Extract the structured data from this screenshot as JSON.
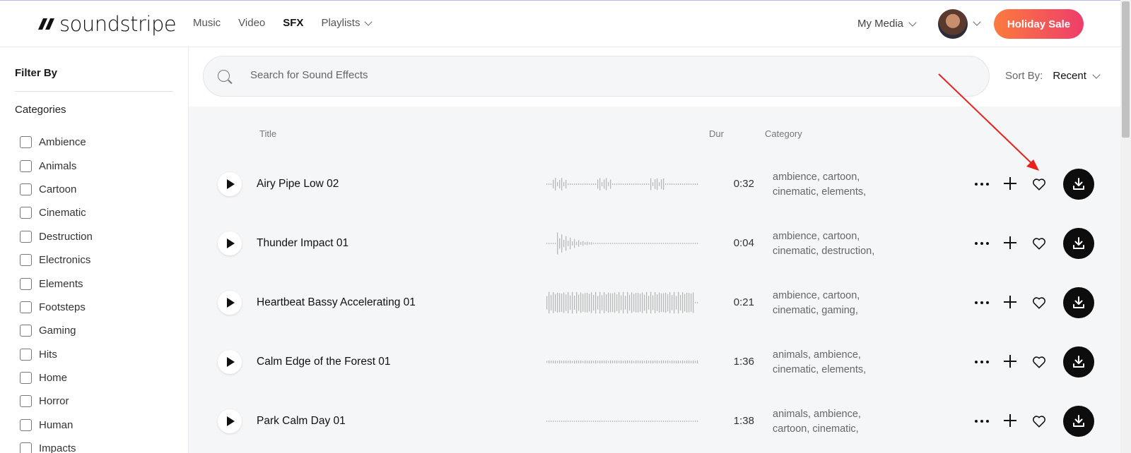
{
  "header": {
    "logo_text": "soundstripe",
    "nav": [
      {
        "label": "Music"
      },
      {
        "label": "Video"
      },
      {
        "label": "SFX"
      },
      {
        "label": "Playlists"
      }
    ],
    "my_media": "My Media",
    "holiday_sale": "Holiday Sale"
  },
  "sidebar": {
    "filter_title": "Filter By",
    "categories_title": "Categories",
    "categories": [
      {
        "label": "Ambience"
      },
      {
        "label": "Animals"
      },
      {
        "label": "Cartoon"
      },
      {
        "label": "Cinematic"
      },
      {
        "label": "Destruction"
      },
      {
        "label": "Electronics"
      },
      {
        "label": "Elements"
      },
      {
        "label": "Footsteps"
      },
      {
        "label": "Gaming"
      },
      {
        "label": "Hits"
      },
      {
        "label": "Home"
      },
      {
        "label": "Horror"
      },
      {
        "label": "Human"
      },
      {
        "label": "Impacts"
      }
    ]
  },
  "search": {
    "placeholder": "Search for Sound Effects",
    "sort_label": "Sort By:",
    "sort_value": "Recent"
  },
  "table": {
    "headers": {
      "title": "Title",
      "dur": "Dur",
      "category": "Category"
    },
    "rows": [
      {
        "title": "Airy Pipe Low 02",
        "dur": "0:32",
        "cat1": "ambience, cartoon,",
        "cat2": "cinematic, elements,"
      },
      {
        "title": "Thunder Impact 01",
        "dur": "0:04",
        "cat1": "ambience, cartoon,",
        "cat2": "cinematic, destruction,"
      },
      {
        "title": "Heartbeat Bassy Accelerating 01",
        "dur": "0:21",
        "cat1": "ambience, cartoon,",
        "cat2": "cinematic, gaming,"
      },
      {
        "title": "Calm Edge of the Forest 01",
        "dur": "1:36",
        "cat1": "animals, ambience,",
        "cat2": "cinematic, elements,"
      },
      {
        "title": "Park Calm Day 01",
        "dur": "1:38",
        "cat1": "animals, ambience,",
        "cat2": "cartoon, cinematic,"
      }
    ]
  },
  "colors": {
    "accent_start": "#fb7b3e",
    "accent_end": "#ee3d6b",
    "annotation_arrow": "#e8231c"
  }
}
